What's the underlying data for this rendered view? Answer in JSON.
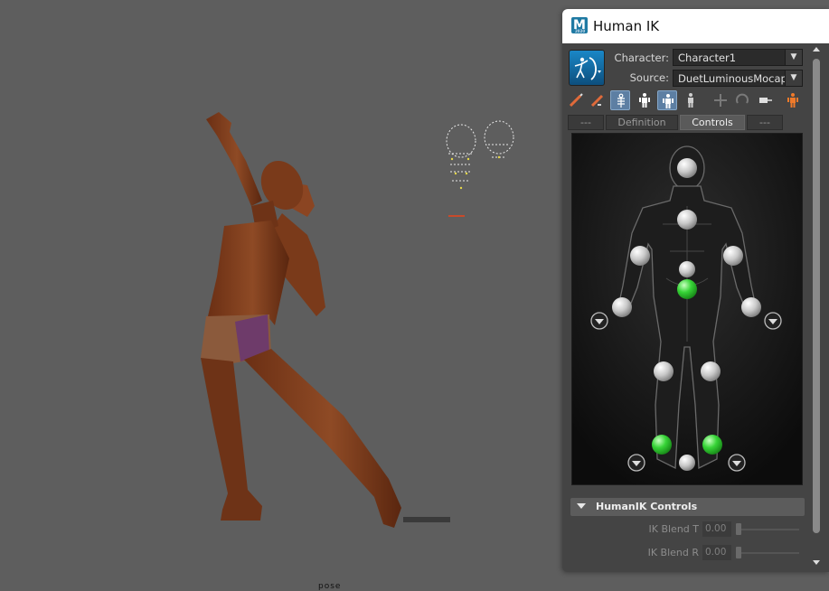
{
  "window": {
    "title": "Human IK",
    "app_logo_letter": "M",
    "app_logo_sub": "2020"
  },
  "character_row": {
    "character_label": "Character:",
    "character_value": "Character1",
    "source_label": "Source:",
    "source_value": "DuetLuminousMocapH"
  },
  "toolbar": {
    "tools": [
      "edit-skeleton-icon",
      "edit-pose-icon",
      "full-body-icon",
      "body-part-icon",
      "selection-icon",
      "pin-icon",
      "translate-pin-icon",
      "rotate-pin-icon",
      "release-icon",
      "human-figure-icon"
    ]
  },
  "tabs": [
    {
      "label": "---"
    },
    {
      "label": "Definition"
    },
    {
      "label": "Controls"
    },
    {
      "label": "---"
    }
  ],
  "section": {
    "title": "HumanIK Controls"
  },
  "sliders": [
    {
      "label": "IK Blend T",
      "value": "0.00"
    },
    {
      "label": "IK Blend R",
      "value": "0.00"
    }
  ],
  "viewport": {
    "bottom_label": "pose"
  },
  "colors": {
    "active_effector": "#33cc33",
    "inactive_effector": "#bdbdbd",
    "skin": "#7a3e1f",
    "accent_blue": "#5d7fa3"
  }
}
